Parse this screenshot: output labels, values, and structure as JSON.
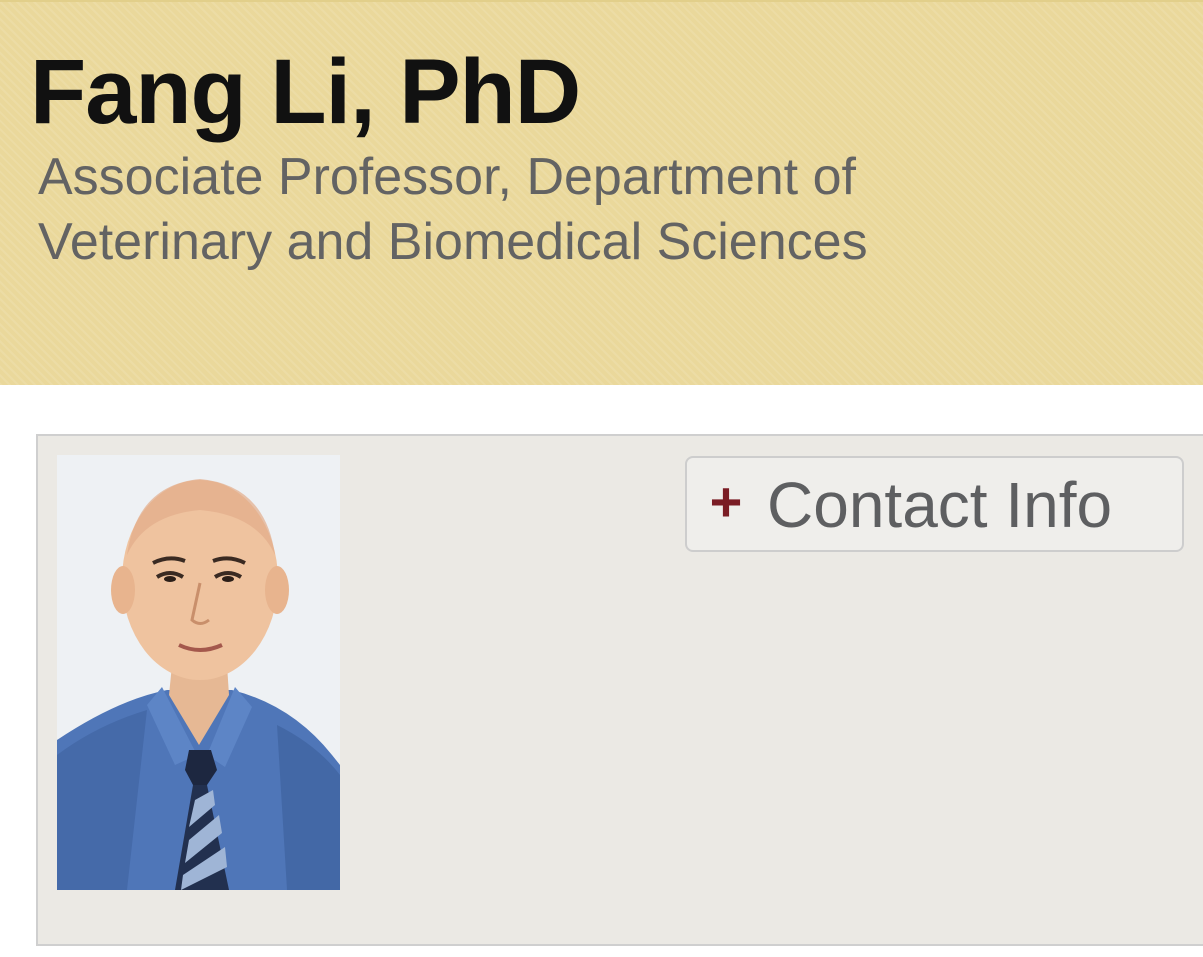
{
  "header": {
    "name": "Fang Li, PhD",
    "title": "Associate Professor, Department of Veterinary and Biomedical Sciences"
  },
  "profile": {
    "photo_icon": "portrait-photo",
    "contact_button": {
      "icon": "plus-icon",
      "icon_glyph": "+",
      "label": "Contact Info"
    }
  },
  "colors": {
    "banner": "#ead89b",
    "card": "#ebe9e4",
    "accent": "#7a1c24",
    "name_text": "#111111",
    "title_text": "#636363"
  }
}
